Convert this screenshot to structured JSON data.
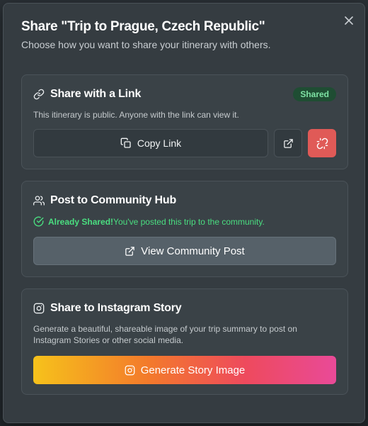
{
  "dialog": {
    "title": "Share \"Trip to Prague, Czech Republic\"",
    "subtitle": "Choose how you want to share your itinerary with others."
  },
  "link_section": {
    "title": "Share with a Link",
    "badge": "Shared",
    "description": "This itinerary is public. Anyone with the link can view it.",
    "copy_label": "Copy Link"
  },
  "community_section": {
    "title": "Post to Community Hub",
    "status_strong": "Already Shared!",
    "status_text": "You've posted this trip to the community.",
    "view_label": "View Community Post"
  },
  "instagram_section": {
    "title": "Share to Instagram Story",
    "description": "Generate a beautiful, shareable image of your trip summary to post on Instagram Stories or other social media.",
    "generate_label": "Generate Story Image"
  },
  "colors": {
    "accent_red": "#e05a57",
    "success_green": "#4ade80",
    "badge_bg": "#1f4d33",
    "gradient_start": "#f6c21b",
    "gradient_end": "#e94a98"
  },
  "icons": {
    "close": "close-icon",
    "link": "link-icon",
    "copy": "copy-icon",
    "external": "external-link-icon",
    "unlink": "unlink-icon",
    "users": "users-icon",
    "check": "check-circle-icon",
    "instagram": "instagram-icon"
  }
}
